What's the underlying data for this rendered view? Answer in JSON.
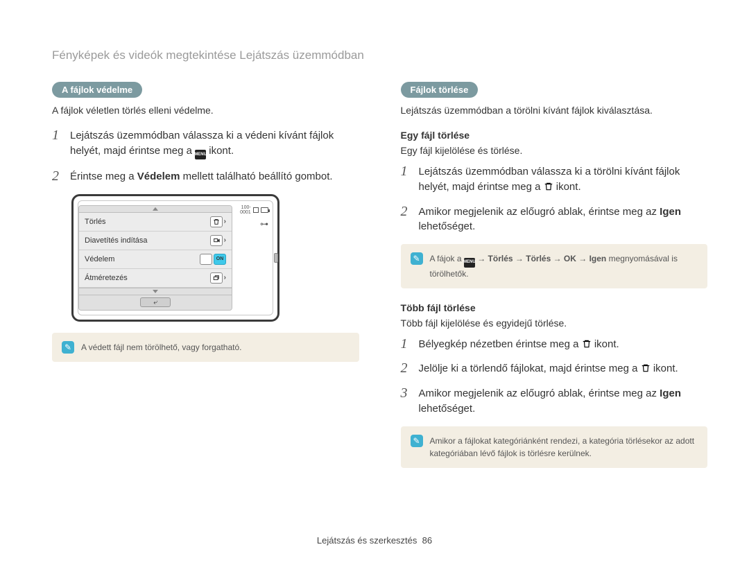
{
  "header": "Fényképek és videók megtekintése Lejátszás üzemmódban",
  "left": {
    "pill": "A fájlok védelme",
    "intro": "A fájlok véletlen törlés elleni védelme.",
    "steps": [
      {
        "pre": "Lejátszás üzemmódban válassza ki a védeni kívánt fájlok helyét, majd érintse meg a ",
        "post": " ikont.",
        "icon": "MENU"
      },
      {
        "pre": "Érintse meg a ",
        "bold": "Védelem",
        "post": " mellett található beállító gombot."
      }
    ],
    "menu": {
      "counter": "100-0001",
      "items": [
        {
          "label": "Törlés",
          "icon": "trash"
        },
        {
          "label": "Diavetítés indítása",
          "icon": "slideshow"
        },
        {
          "label": "Védelem",
          "icon": "on"
        },
        {
          "label": "Átméretezés",
          "icon": "resize"
        }
      ],
      "on_label": "ON"
    },
    "note": "A védett fájl nem törölhető, vagy forgatható."
  },
  "right": {
    "pill": "Fájlok törlése",
    "intro": "Lejátszás üzemmódban a törölni kívánt fájlok kiválasztása.",
    "sub1_title": "Egy fájl törlése",
    "sub1_text": "Egy fájl kijelölése és törlése.",
    "sub1_steps": [
      {
        "pre": "Lejátszás üzemmódban válassza ki a törölni kívánt fájlok helyét, majd érintse meg a ",
        "icon": "trash",
        "post": " ikont."
      },
      {
        "pre": "Amikor megjelenik az előugró ablak, érintse meg az ",
        "bold": "Igen",
        "post": " lehetőséget."
      }
    ],
    "note1_parts": {
      "a": "A fájok a ",
      "b": " → ",
      "c": "Törlés",
      "d": " → ",
      "e": "Törlés",
      "f": " → ",
      "g": "OK",
      "h": " → ",
      "i": "Igen",
      "j": " megnyomásával is törölhetők."
    },
    "sub2_title": "Több fájl törlése",
    "sub2_text": "Több fájl kijelölése és egyidejű törlése.",
    "sub2_steps": [
      {
        "pre": "Bélyegkép nézetben érintse meg a ",
        "icon": "trash",
        "post": " ikont."
      },
      {
        "pre": "Jelölje ki a törlendő fájlokat, majd érintse meg a ",
        "icon": "trash",
        "post": " ikont."
      },
      {
        "pre": "Amikor megjelenik az előugró ablak, érintse meg az ",
        "bold": "Igen",
        "post": " lehetőséget."
      }
    ],
    "note2": "Amikor a fájlokat kategóriánként rendezi, a kategória törlésekor az adott kategóriában lévő fájlok is törlésre kerülnek."
  },
  "footer": {
    "label": "Lejátszás és szerkesztés",
    "page": "86"
  }
}
